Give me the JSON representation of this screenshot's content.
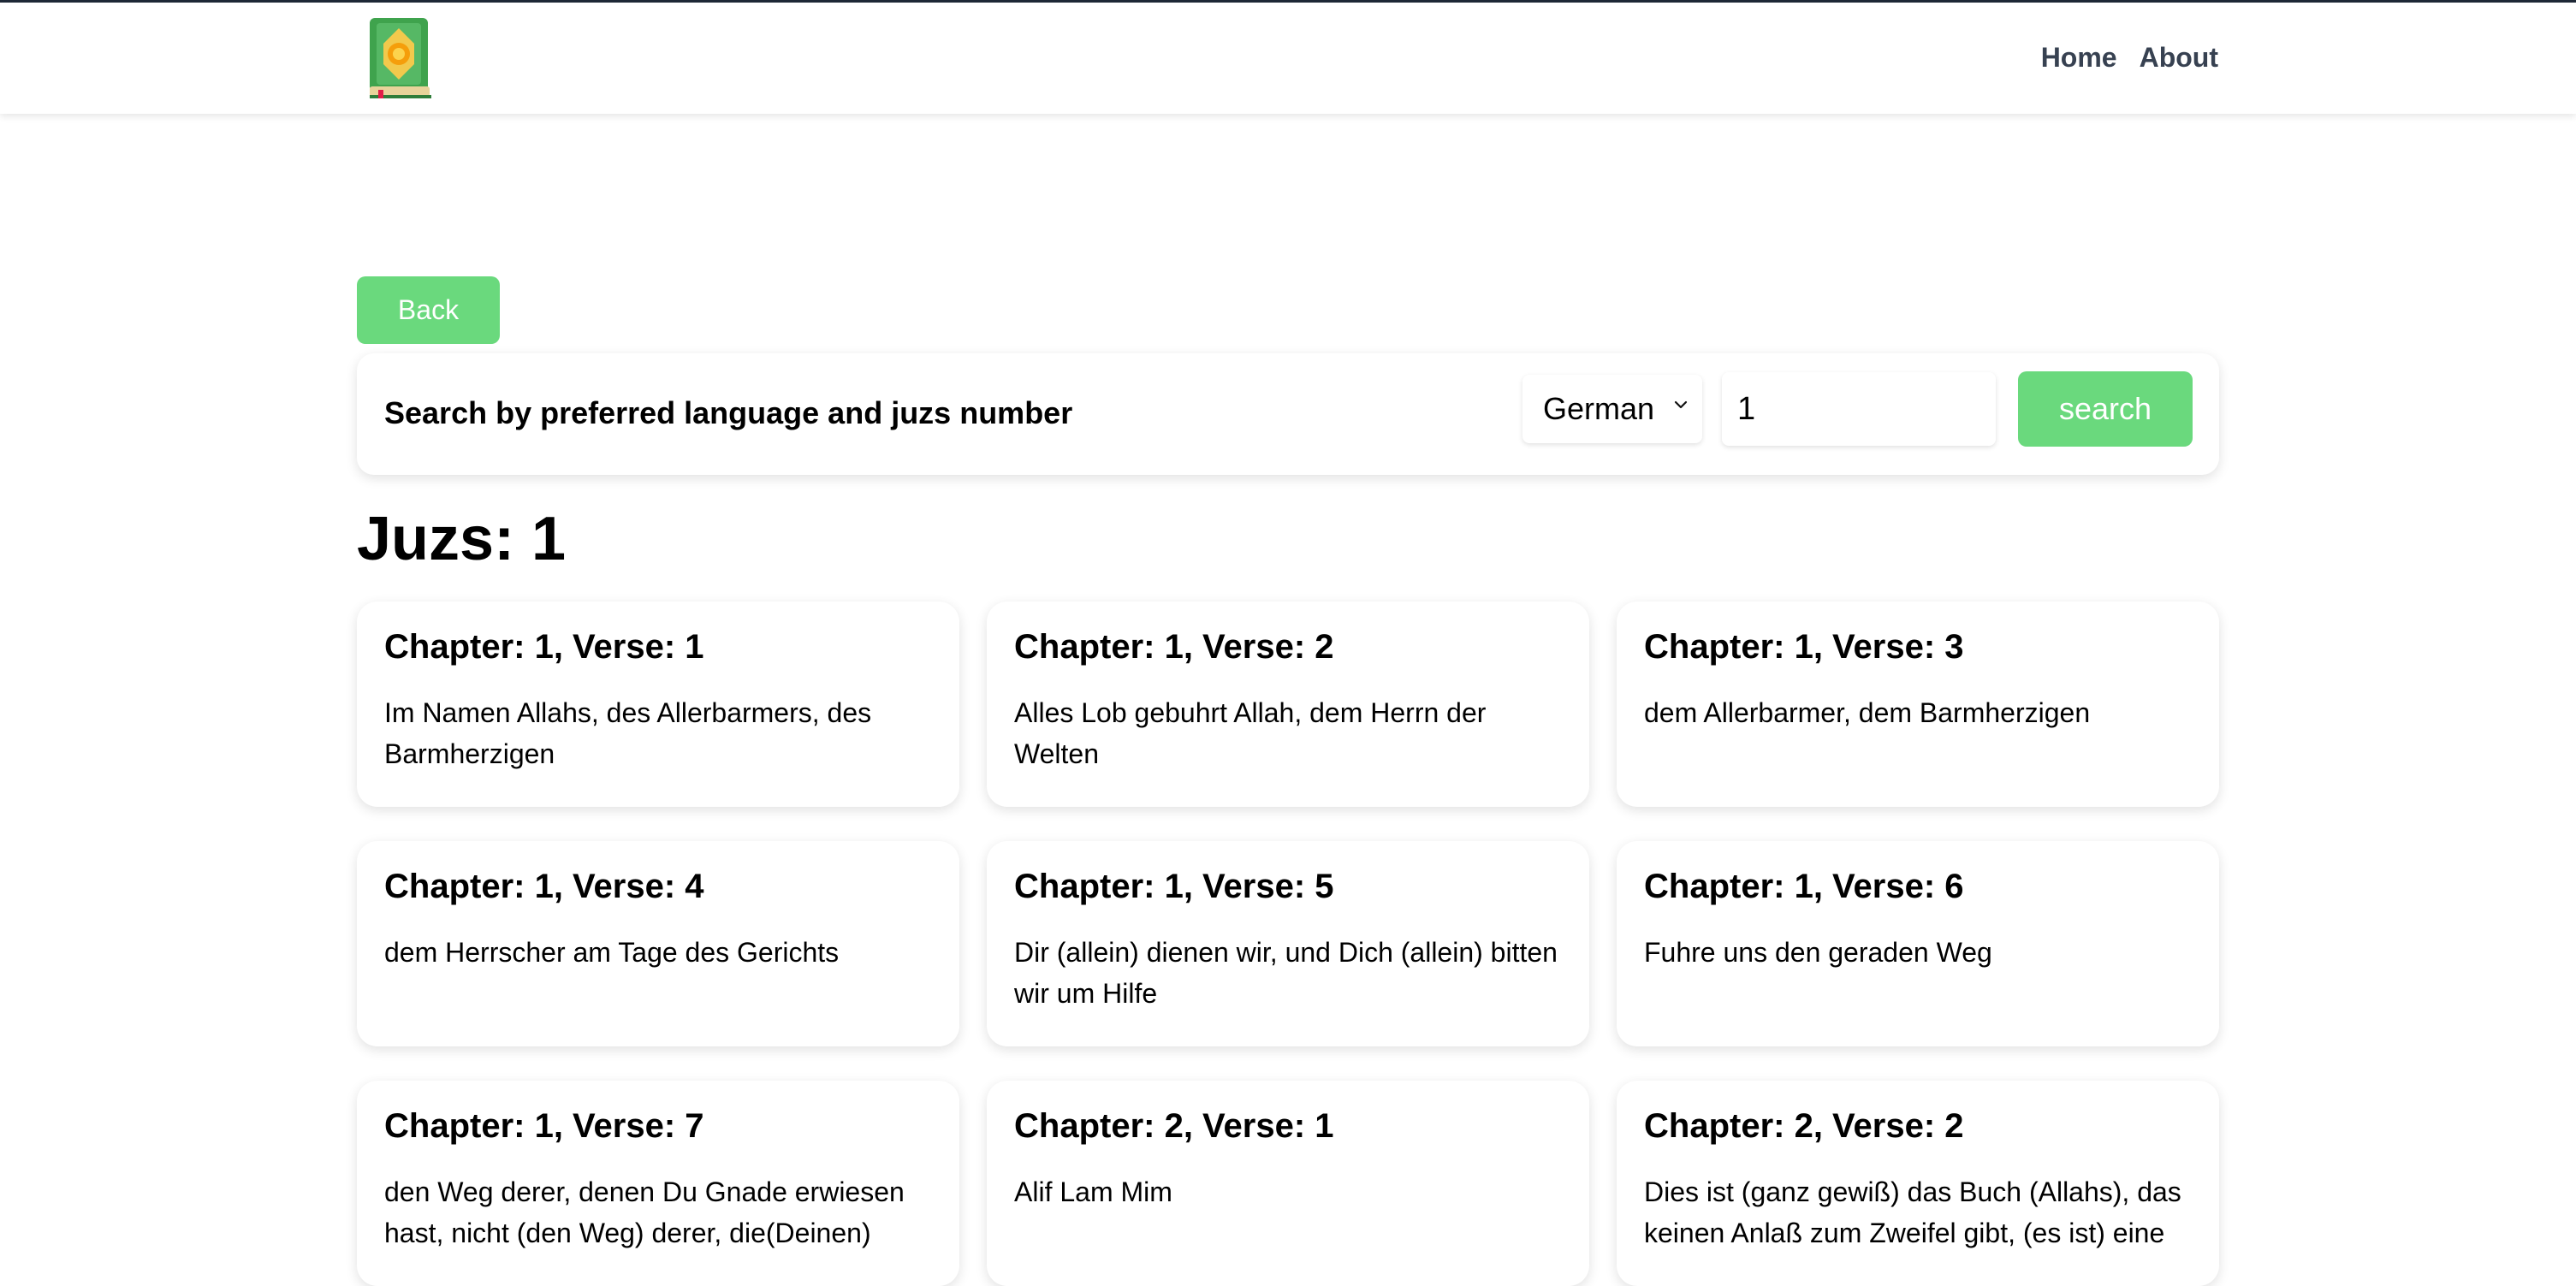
{
  "nav": {
    "logo_icon": "quran-book-icon",
    "links": [
      "Home",
      "About"
    ]
  },
  "back_button": "Back",
  "search": {
    "title": "Search by preferred language and juzs number",
    "language": "German",
    "juz_value": "1",
    "button": "search"
  },
  "page_title": "Juzs: 1",
  "colors": {
    "accent": "#6ad97d",
    "nav_text": "#374151"
  },
  "verses": [
    {
      "title": "Chapter: 1, Verse: 1",
      "text": "Im Namen Allahs, des Allerbarmers, des Barmherzigen"
    },
    {
      "title": "Chapter: 1, Verse: 2",
      "text": "Alles Lob gebuhrt Allah, dem Herrn der Welten"
    },
    {
      "title": "Chapter: 1, Verse: 3",
      "text": "dem Allerbarmer, dem Barmherzigen"
    },
    {
      "title": "Chapter: 1, Verse: 4",
      "text": "dem Herrscher am Tage des Gerichts"
    },
    {
      "title": "Chapter: 1, Verse: 5",
      "text": "Dir (allein) dienen wir, und Dich (allein) bitten wir um Hilfe"
    },
    {
      "title": "Chapter: 1, Verse: 6",
      "text": "Fuhre uns den geraden Weg"
    },
    {
      "title": "Chapter: 1, Verse: 7",
      "text": "den Weg derer, denen Du Gnade erwiesen hast, nicht (den Weg) derer, die(Deinen)"
    },
    {
      "title": "Chapter: 2, Verse: 1",
      "text": "Alif Lam Mim"
    },
    {
      "title": "Chapter: 2, Verse: 2",
      "text": "Dies ist (ganz gewiß) das Buch (Allahs), das keinen Anlaß zum Zweifel gibt, (es ist) eine"
    }
  ]
}
